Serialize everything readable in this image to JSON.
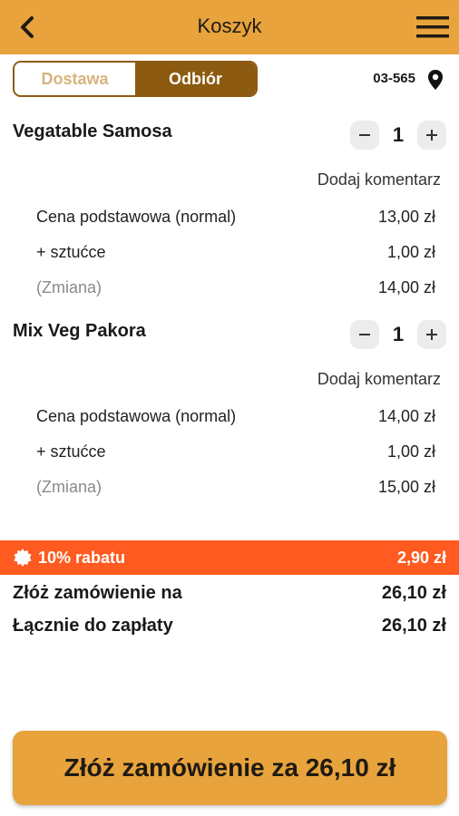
{
  "header": {
    "title": "Koszyk"
  },
  "mode": {
    "delivery_label": "Dostawa",
    "pickup_label": "Odbiór",
    "selected": "Odbiór"
  },
  "location": {
    "postcode": "03-565"
  },
  "items": [
    {
      "name": "Vegatable Samosa",
      "quantity": "1",
      "comment_link": "Dodaj komentarz",
      "lines": [
        {
          "label": "Cena podstawowa (normal)",
          "value": "13,00 zł"
        },
        {
          "label": "+ sztućce",
          "value": "1,00 zł"
        },
        {
          "label": "(Zmiana)",
          "value": "14,00 zł"
        }
      ]
    },
    {
      "name": "Mix Veg Pakora",
      "quantity": "1",
      "comment_link": "Dodaj komentarz",
      "lines": [
        {
          "label": "Cena podstawowa (normal)",
          "value": "14,00 zł"
        },
        {
          "label": "+ sztućce",
          "value": "1,00 zł"
        },
        {
          "label": "(Zmiana)",
          "value": "15,00 zł"
        }
      ]
    }
  ],
  "discount": {
    "label": "10% rabatu",
    "value": "2,90 zł"
  },
  "totals": [
    {
      "label": "Złóż zamówienie na",
      "value": "26,10 zł"
    },
    {
      "label": "Łącznie do zapłaty",
      "value": "26,10 zł"
    }
  ],
  "order_button": {
    "label": "Złóż zamówienie za 26,10 zł"
  },
  "colors": {
    "accent": "#e8a33d",
    "brand_dark": "#8c5a10",
    "discount": "#ff5a1f"
  }
}
